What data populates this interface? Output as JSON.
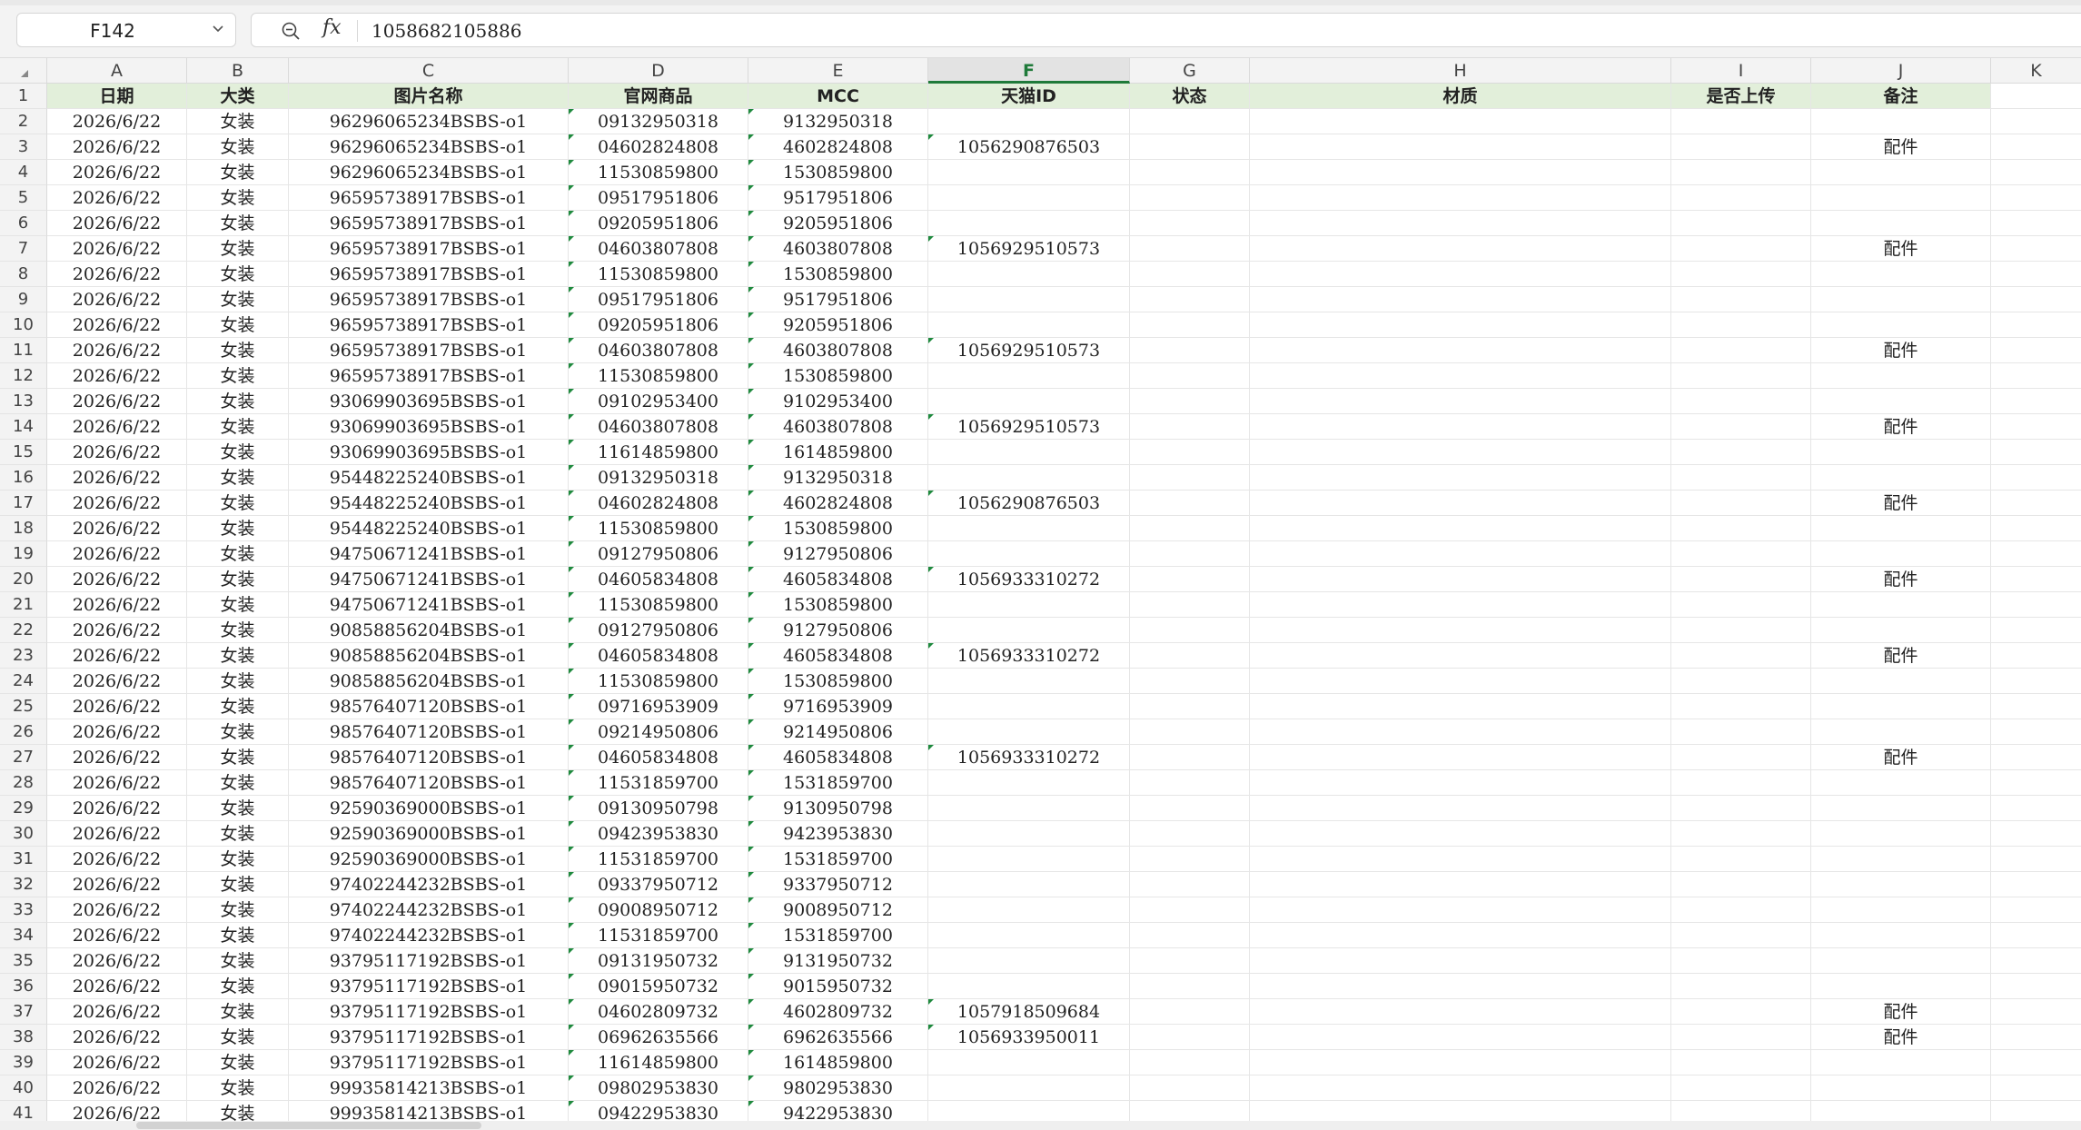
{
  "formula_bar": {
    "name_box": "F142",
    "fx_label": "fx",
    "value": "1058682105886"
  },
  "columns": [
    "A",
    "B",
    "C",
    "D",
    "E",
    "F",
    "G",
    "H",
    "I",
    "J",
    "K"
  ],
  "selected_column": "F",
  "header_row": {
    "number": "1",
    "cells": [
      "日期",
      "大类",
      "图片名称",
      "官网商品",
      "MCC",
      "天猫ID",
      "状态",
      "材质",
      "是否上传",
      "备注",
      ""
    ]
  },
  "rows": [
    {
      "n": "2",
      "cells": [
        "2026/6/22",
        "女装",
        "96296065234BSBS-o1",
        "09132950318",
        "9132950318",
        "",
        "",
        "",
        "",
        "",
        ""
      ]
    },
    {
      "n": "3",
      "cells": [
        "2026/6/22",
        "女装",
        "96296065234BSBS-o1",
        "04602824808",
        "4602824808",
        "1056290876503",
        "",
        "",
        "",
        "配件",
        ""
      ]
    },
    {
      "n": "4",
      "cells": [
        "2026/6/22",
        "女装",
        "96296065234BSBS-o1",
        "11530859800",
        "1530859800",
        "",
        "",
        "",
        "",
        "",
        ""
      ]
    },
    {
      "n": "5",
      "cells": [
        "2026/6/22",
        "女装",
        "96595738917BSBS-o1",
        "09517951806",
        "9517951806",
        "",
        "",
        "",
        "",
        "",
        ""
      ]
    },
    {
      "n": "6",
      "cells": [
        "2026/6/22",
        "女装",
        "96595738917BSBS-o1",
        "09205951806",
        "9205951806",
        "",
        "",
        "",
        "",
        "",
        ""
      ]
    },
    {
      "n": "7",
      "cells": [
        "2026/6/22",
        "女装",
        "96595738917BSBS-o1",
        "04603807808",
        "4603807808",
        "1056929510573",
        "",
        "",
        "",
        "配件",
        ""
      ]
    },
    {
      "n": "8",
      "cells": [
        "2026/6/22",
        "女装",
        "96595738917BSBS-o1",
        "11530859800",
        "1530859800",
        "",
        "",
        "",
        "",
        "",
        ""
      ]
    },
    {
      "n": "9",
      "cells": [
        "2026/6/22",
        "女装",
        "96595738917BSBS-o1",
        "09517951806",
        "9517951806",
        "",
        "",
        "",
        "",
        "",
        ""
      ]
    },
    {
      "n": "10",
      "cells": [
        "2026/6/22",
        "女装",
        "96595738917BSBS-o1",
        "09205951806",
        "9205951806",
        "",
        "",
        "",
        "",
        "",
        ""
      ]
    },
    {
      "n": "11",
      "cells": [
        "2026/6/22",
        "女装",
        "96595738917BSBS-o1",
        "04603807808",
        "4603807808",
        "1056929510573",
        "",
        "",
        "",
        "配件",
        ""
      ]
    },
    {
      "n": "12",
      "cells": [
        "2026/6/22",
        "女装",
        "96595738917BSBS-o1",
        "11530859800",
        "1530859800",
        "",
        "",
        "",
        "",
        "",
        ""
      ]
    },
    {
      "n": "13",
      "cells": [
        "2026/6/22",
        "女装",
        "93069903695BSBS-o1",
        "09102953400",
        "9102953400",
        "",
        "",
        "",
        "",
        "",
        ""
      ]
    },
    {
      "n": "14",
      "cells": [
        "2026/6/22",
        "女装",
        "93069903695BSBS-o1",
        "04603807808",
        "4603807808",
        "1056929510573",
        "",
        "",
        "",
        "配件",
        ""
      ]
    },
    {
      "n": "15",
      "cells": [
        "2026/6/22",
        "女装",
        "93069903695BSBS-o1",
        "11614859800",
        "1614859800",
        "",
        "",
        "",
        "",
        "",
        ""
      ]
    },
    {
      "n": "16",
      "cells": [
        "2026/6/22",
        "女装",
        "95448225240BSBS-o1",
        "09132950318",
        "9132950318",
        "",
        "",
        "",
        "",
        "",
        ""
      ]
    },
    {
      "n": "17",
      "cells": [
        "2026/6/22",
        "女装",
        "95448225240BSBS-o1",
        "04602824808",
        "4602824808",
        "1056290876503",
        "",
        "",
        "",
        "配件",
        ""
      ]
    },
    {
      "n": "18",
      "cells": [
        "2026/6/22",
        "女装",
        "95448225240BSBS-o1",
        "11530859800",
        "1530859800",
        "",
        "",
        "",
        "",
        "",
        ""
      ]
    },
    {
      "n": "19",
      "cells": [
        "2026/6/22",
        "女装",
        "94750671241BSBS-o1",
        "09127950806",
        "9127950806",
        "",
        "",
        "",
        "",
        "",
        ""
      ]
    },
    {
      "n": "20",
      "cells": [
        "2026/6/22",
        "女装",
        "94750671241BSBS-o1",
        "04605834808",
        "4605834808",
        "1056933310272",
        "",
        "",
        "",
        "配件",
        ""
      ]
    },
    {
      "n": "21",
      "cells": [
        "2026/6/22",
        "女装",
        "94750671241BSBS-o1",
        "11530859800",
        "1530859800",
        "",
        "",
        "",
        "",
        "",
        ""
      ]
    },
    {
      "n": "22",
      "cells": [
        "2026/6/22",
        "女装",
        "90858856204BSBS-o1",
        "09127950806",
        "9127950806",
        "",
        "",
        "",
        "",
        "",
        ""
      ]
    },
    {
      "n": "23",
      "cells": [
        "2026/6/22",
        "女装",
        "90858856204BSBS-o1",
        "04605834808",
        "4605834808",
        "1056933310272",
        "",
        "",
        "",
        "配件",
        ""
      ]
    },
    {
      "n": "24",
      "cells": [
        "2026/6/22",
        "女装",
        "90858856204BSBS-o1",
        "11530859800",
        "1530859800",
        "",
        "",
        "",
        "",
        "",
        ""
      ]
    },
    {
      "n": "25",
      "cells": [
        "2026/6/22",
        "女装",
        "98576407120BSBS-o1",
        "09716953909",
        "9716953909",
        "",
        "",
        "",
        "",
        "",
        ""
      ]
    },
    {
      "n": "26",
      "cells": [
        "2026/6/22",
        "女装",
        "98576407120BSBS-o1",
        "09214950806",
        "9214950806",
        "",
        "",
        "",
        "",
        "",
        ""
      ]
    },
    {
      "n": "27",
      "cells": [
        "2026/6/22",
        "女装",
        "98576407120BSBS-o1",
        "04605834808",
        "4605834808",
        "1056933310272",
        "",
        "",
        "",
        "配件",
        ""
      ]
    },
    {
      "n": "28",
      "cells": [
        "2026/6/22",
        "女装",
        "98576407120BSBS-o1",
        "11531859700",
        "1531859700",
        "",
        "",
        "",
        "",
        "",
        ""
      ]
    },
    {
      "n": "29",
      "cells": [
        "2026/6/22",
        "女装",
        "92590369000BSBS-o1",
        "09130950798",
        "9130950798",
        "",
        "",
        "",
        "",
        "",
        ""
      ]
    },
    {
      "n": "30",
      "cells": [
        "2026/6/22",
        "女装",
        "92590369000BSBS-o1",
        "09423953830",
        "9423953830",
        "",
        "",
        "",
        "",
        "",
        ""
      ]
    },
    {
      "n": "31",
      "cells": [
        "2026/6/22",
        "女装",
        "92590369000BSBS-o1",
        "11531859700",
        "1531859700",
        "",
        "",
        "",
        "",
        "",
        ""
      ]
    },
    {
      "n": "32",
      "cells": [
        "2026/6/22",
        "女装",
        "97402244232BSBS-o1",
        "09337950712",
        "9337950712",
        "",
        "",
        "",
        "",
        "",
        ""
      ]
    },
    {
      "n": "33",
      "cells": [
        "2026/6/22",
        "女装",
        "97402244232BSBS-o1",
        "09008950712",
        "9008950712",
        "",
        "",
        "",
        "",
        "",
        ""
      ]
    },
    {
      "n": "34",
      "cells": [
        "2026/6/22",
        "女装",
        "97402244232BSBS-o1",
        "11531859700",
        "1531859700",
        "",
        "",
        "",
        "",
        "",
        ""
      ]
    },
    {
      "n": "35",
      "cells": [
        "2026/6/22",
        "女装",
        "93795117192BSBS-o1",
        "09131950732",
        "9131950732",
        "",
        "",
        "",
        "",
        "",
        ""
      ]
    },
    {
      "n": "36",
      "cells": [
        "2026/6/22",
        "女装",
        "93795117192BSBS-o1",
        "09015950732",
        "9015950732",
        "",
        "",
        "",
        "",
        "",
        ""
      ]
    },
    {
      "n": "37",
      "cells": [
        "2026/6/22",
        "女装",
        "93795117192BSBS-o1",
        "04602809732",
        "4602809732",
        "1057918509684",
        "",
        "",
        "",
        "配件",
        ""
      ]
    },
    {
      "n": "38",
      "cells": [
        "2026/6/22",
        "女装",
        "93795117192BSBS-o1",
        "06962635566",
        "6962635566",
        "1056933950011",
        "",
        "",
        "",
        "配件",
        ""
      ]
    },
    {
      "n": "39",
      "cells": [
        "2026/6/22",
        "女装",
        "93795117192BSBS-o1",
        "11614859800",
        "1614859800",
        "",
        "",
        "",
        "",
        "",
        ""
      ]
    },
    {
      "n": "40",
      "cells": [
        "2026/6/22",
        "女装",
        "99935814213BSBS-o1",
        "09802953830",
        "9802953830",
        "",
        "",
        "",
        "",
        "",
        ""
      ]
    },
    {
      "n": "41",
      "cells": [
        "2026/6/22",
        "女装",
        "99935814213BSBS-o1",
        "09422953830",
        "9422953830",
        "",
        "",
        "",
        "",
        "",
        ""
      ]
    }
  ]
}
